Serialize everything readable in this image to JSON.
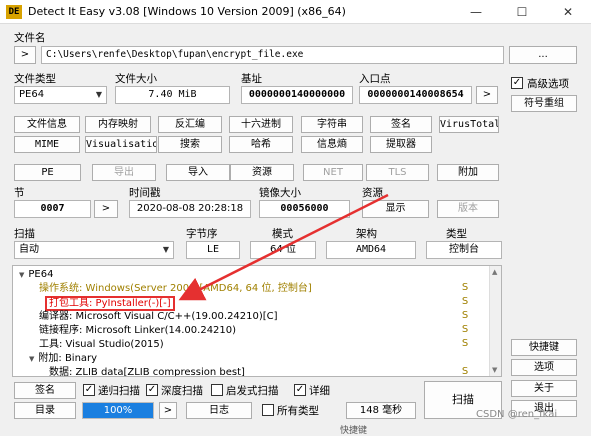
{
  "window": {
    "title": "Detect It Easy v3.08 [Windows 10 Version 2009] (x86_64)",
    "icon_text": "DE",
    "minimize": "—",
    "maximize": "☐",
    "close": "✕"
  },
  "file": {
    "label": "文件名",
    "nav_button": ">",
    "path": "C:\\Users\\renfe\\Desktop\\fupan\\encrypt_file.exe",
    "browse": "..."
  },
  "info": {
    "filetype_label": "文件类型",
    "filetype_value": "PE64",
    "filesize_label": "文件大小",
    "filesize_value": "7.40 MiB",
    "base_label": "基址",
    "base_value": "0000000140000000",
    "entry_label": "入口点",
    "entry_value": "0000000140008654",
    "entry_nav": ">"
  },
  "right_panel": {
    "advanced_label": "高级选项",
    "advanced_checked": "✓",
    "symbols_button": "符号重组",
    "shortcut_button": "快捷键",
    "options_button": "选项",
    "about_button": "关于",
    "exit_button": "退出"
  },
  "toolbar1": [
    "文件信息",
    "内存映射",
    "反汇编",
    "十六进制",
    "字符串",
    "签名",
    "VirusTotal"
  ],
  "toolbar2": [
    "MIME",
    "Visualisation",
    "搜索",
    "哈希",
    "信息熵",
    "提取器"
  ],
  "toolbar3": {
    "pe": "PE",
    "export": "导出",
    "import": "导入",
    "resources": "资源",
    "net": "NET",
    "tls": "TLS",
    "overlay": "附加"
  },
  "sections": {
    "section_label": "节",
    "section_value": "0007",
    "section_nav": ">",
    "timestamp_label": "时间戳",
    "timestamp_value": "2020-08-08 20:28:18",
    "imagesize_label": "镜像大小",
    "imagesize_value": "00056000",
    "resource_label": "资源",
    "show_button": "显示",
    "version_button": "版本"
  },
  "scan": {
    "scan_label": "扫描",
    "scan_mode": "自动",
    "endian_label": "字节序",
    "endian_value": "LE",
    "mode_label": "模式",
    "mode_value": "64 位",
    "arch_label": "架构",
    "arch_value": "AMD64",
    "type_label": "类型",
    "type_value": "控制台"
  },
  "tree": [
    {
      "text": "PE64",
      "indent": 0,
      "toggle": "▼",
      "color": "#000000",
      "s": "",
      "q": ""
    },
    {
      "text": "操作系统: Windows(Server 2003)[AMD64, 64 位, 控制台]",
      "indent": 2,
      "toggle": "",
      "color": "#a08000",
      "s": "S",
      "q": "?"
    },
    {
      "text": "打包工具: PyInstaller(-)[-]",
      "indent": 2,
      "toggle": "",
      "color": "#e00000",
      "s": "S",
      "q": "?"
    },
    {
      "text": "编译器: Microsoft Visual C/C++(19.00.24210)[C]",
      "indent": 2,
      "toggle": "",
      "color": "#000000",
      "s": "S",
      "q": "?"
    },
    {
      "text": "链接程序: Microsoft Linker(14.00.24210)",
      "indent": 2,
      "toggle": "",
      "color": "#000000",
      "s": "S",
      "q": "?"
    },
    {
      "text": "工具: Visual Studio(2015)",
      "indent": 2,
      "toggle": "",
      "color": "#000000",
      "s": "S",
      "q": "?"
    },
    {
      "text": "附加: Binary",
      "indent": 1,
      "toggle": "▼",
      "color": "#000000",
      "s": "",
      "q": ""
    },
    {
      "text": "数据: ZLIB data[ZLIB compression best]",
      "indent": 3,
      "toggle": "",
      "color": "#000000",
      "s": "S",
      "q": "?"
    }
  ],
  "bottom": {
    "signature_button": "签名",
    "recursive_label": "递归扫描",
    "recursive_checked": "✓",
    "deep_label": "深度扫描",
    "deep_checked": "✓",
    "heuristic_label": "启发式扫描",
    "heuristic_checked": "",
    "verbose_label": "详细",
    "verbose_checked": "✓",
    "directory_button": "目录",
    "progress_text": "100%",
    "progress_value": 1.0,
    "nav_button": ">",
    "log_button": "日志",
    "alltypes_label": "所有类型",
    "alltypes_checked": "",
    "time_button": "148 毫秒",
    "scan_button": "扫描"
  },
  "watermark": "CSDN @ren_fkai",
  "behind_text": "快捷键",
  "colors": {
    "progress": "#1a7fe0",
    "annotation": "#e53030",
    "selected": "#dde8f8"
  }
}
